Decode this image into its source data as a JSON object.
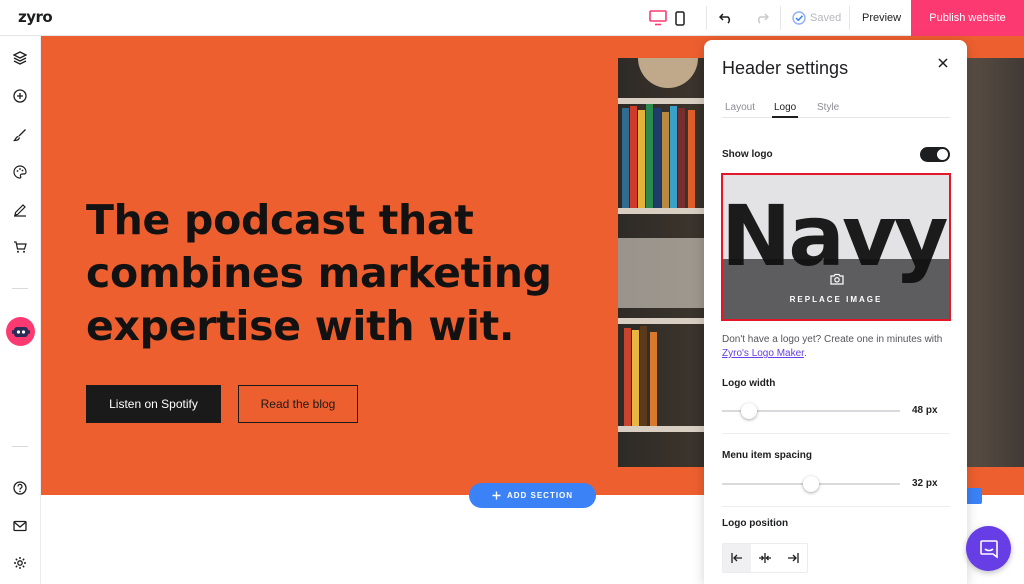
{
  "topbar": {
    "brand": "zyro",
    "saved_label": "Saved",
    "preview_label": "Preview",
    "publish_label": "Publish website"
  },
  "hero": {
    "headline": "The podcast that combines marketing expertise with wit.",
    "primary_button": "Listen on Spotify",
    "secondary_button": "Read the blog"
  },
  "add_section_label": "ADD SECTION",
  "panel": {
    "title": "Header settings",
    "tabs": [
      {
        "label": "Layout",
        "active": false
      },
      {
        "label": "Logo",
        "active": true
      },
      {
        "label": "Style",
        "active": false
      }
    ],
    "show_logo_label": "Show logo",
    "show_logo_on": true,
    "logo_text": "Navy",
    "replace_image_label": "REPLACE IMAGE",
    "help_text": "Don't have a logo yet? Create one in minutes with ",
    "help_link": "Zyro's Logo Maker",
    "help_suffix": ".",
    "logo_width_label": "Logo width",
    "logo_width_value": "48 px",
    "logo_width_fraction": 0.12,
    "menu_spacing_label": "Menu item spacing",
    "menu_spacing_value": "32 px",
    "menu_spacing_fraction": 0.5,
    "logo_position_label": "Logo position",
    "logo_position_options": [
      "align-left-icon",
      "align-center-icon",
      "align-right-icon"
    ],
    "logo_position_selected": 0
  },
  "colors": {
    "accent": "#fc3a71",
    "hero_bg": "#ee5f2f",
    "add_section": "#3b82f6",
    "chat": "#673de6",
    "highlight": "#e4172a"
  }
}
